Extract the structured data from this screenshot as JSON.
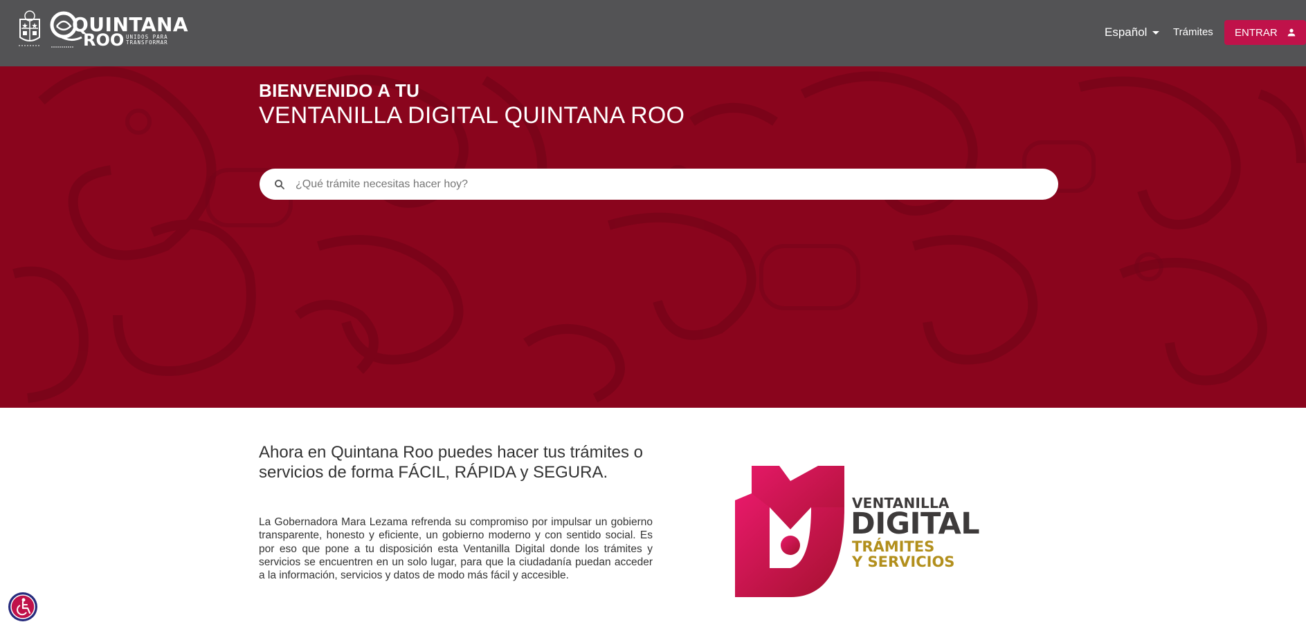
{
  "header": {
    "brand_line1": "QUINTANA",
    "brand_line2": "ROO",
    "brand_tagline": "UNIDOS PARA TRANSFORMAR",
    "language_label": "Español",
    "tramites_label": "Trámites",
    "login_label": "ENTRAR",
    "icons": [
      "state-seal-icon",
      "chevron-down-icon",
      "user-icon"
    ],
    "background_color": "#535355",
    "login_color": "#c0124a"
  },
  "hero": {
    "kicker": "BIENVENIDO A TU",
    "title": "VENTANILLA DIGITAL QUINTANA ROO",
    "search_placeholder": "¿Qué trámite necesitas hacer hoy?",
    "search_icon": "search-icon",
    "background_color": "#8a051d"
  },
  "content": {
    "heading": "Ahora en Quintana Roo puedes hacer tus trámites o servicios de forma FÁCIL, RÁPIDA y SEGURA.",
    "body": "La Gobernadora Mara Lezama refrenda su compromiso por impulsar un gobierno transparente, honesto y eficiente, un gobierno moderno y con sentido social. Es por eso que pone a tu disposición esta Ventanilla Digital donde los trámites y servicios se encuentren en un solo lugar, para que la ciudadanía puedan acceder a la información, servicios y datos de modo más fácil y accesible."
  },
  "vd_logo": {
    "line1": "VENTANILLA",
    "line2": "DIGITAL",
    "line3": "TRÁMITES",
    "line4": "Y SERVICIOS",
    "primary_color": "#e0195b",
    "gold_color": "#b28f1c"
  },
  "accessibility": {
    "icon": "accessibility-icon"
  }
}
